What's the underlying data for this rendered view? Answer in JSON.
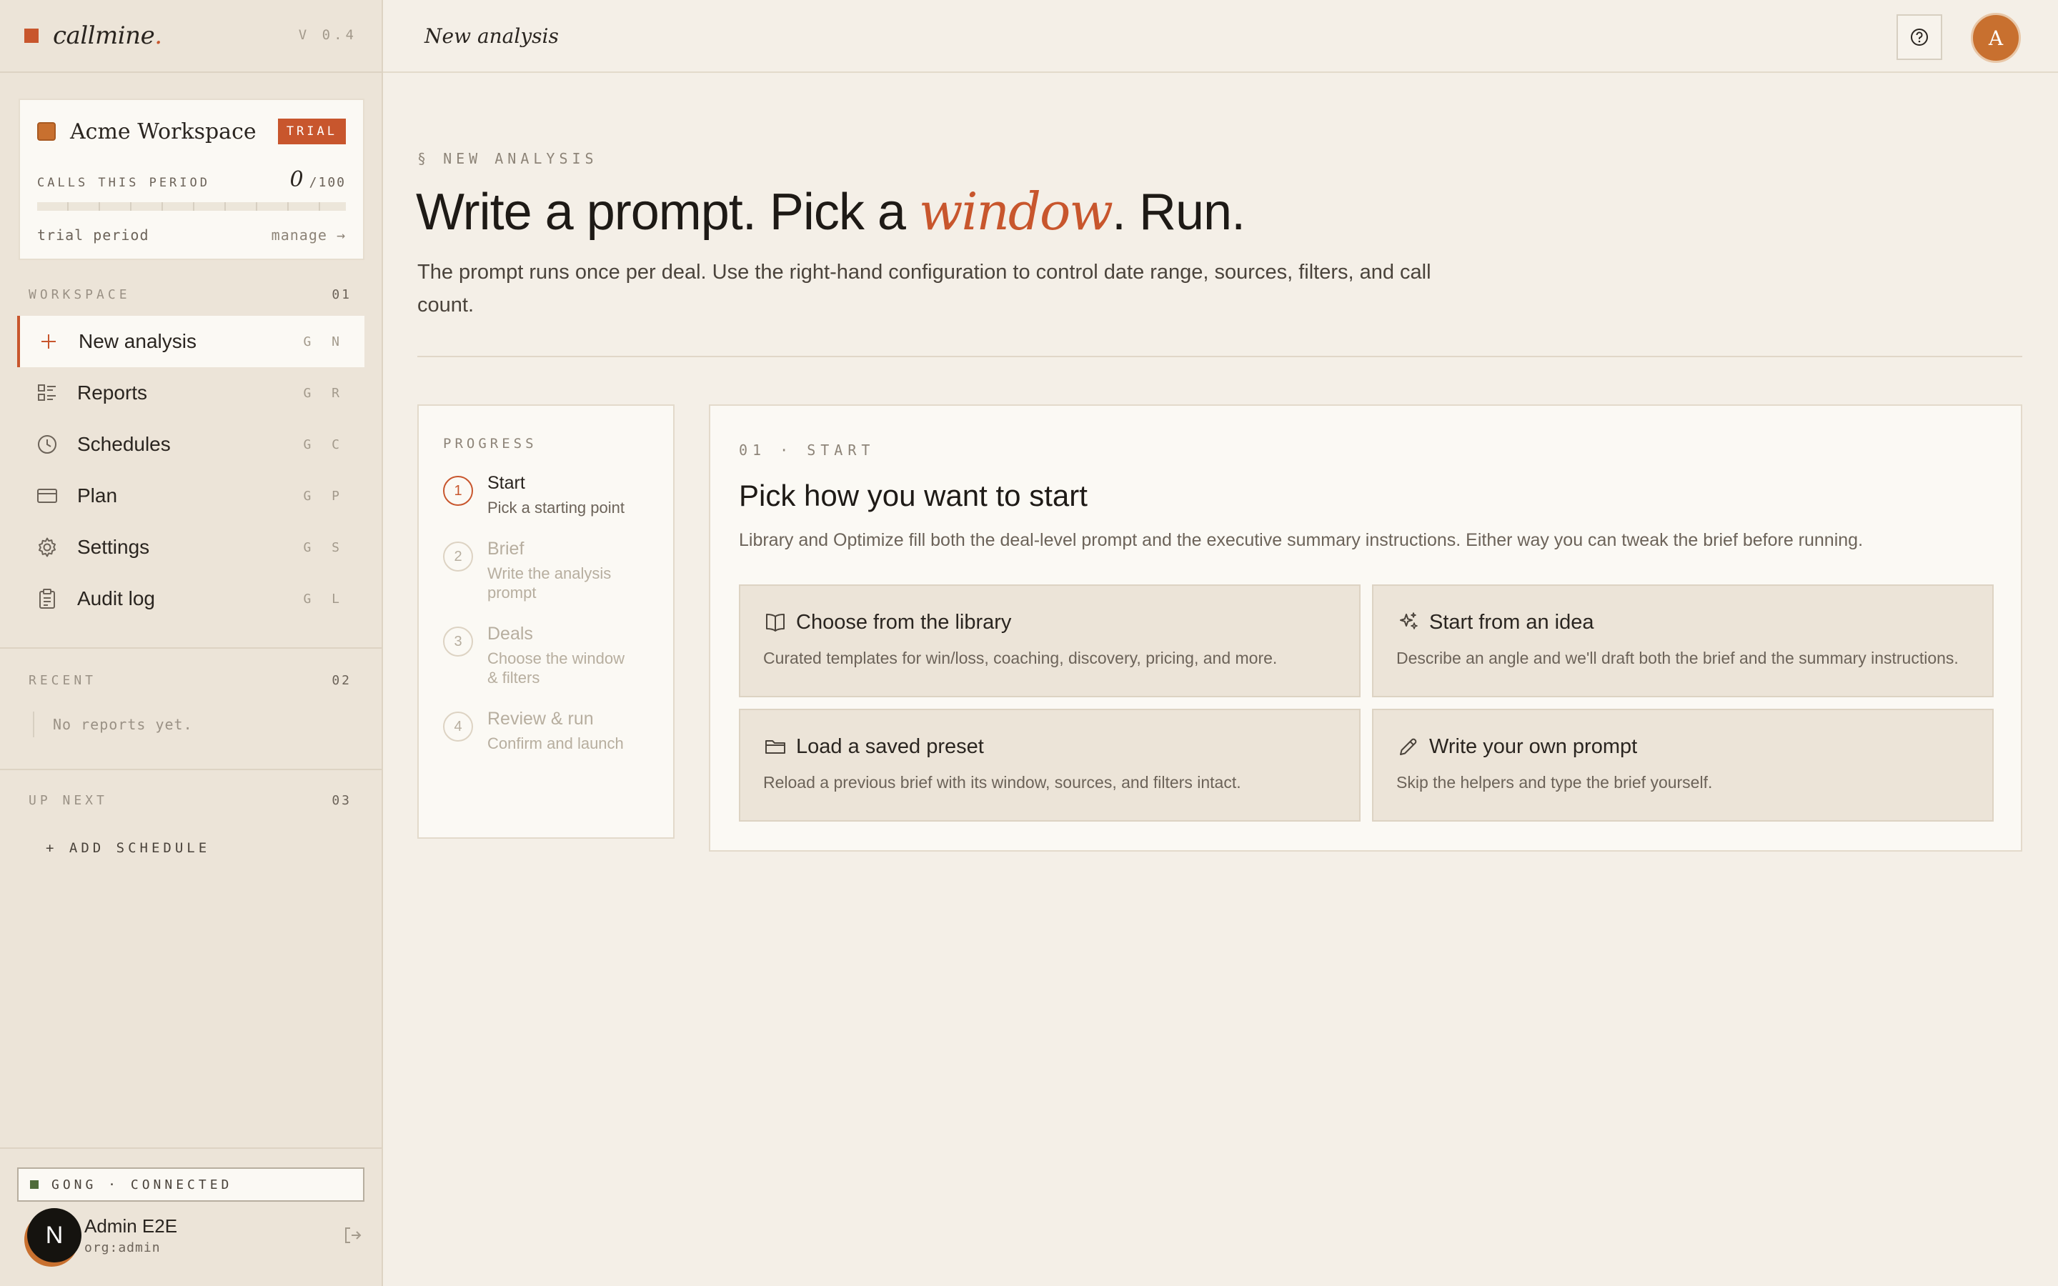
{
  "brand": {
    "name": "callmine",
    "dot": ".",
    "version": "V 0.4"
  },
  "workspace": {
    "name": "Acme Workspace",
    "badge": "TRIAL",
    "calls_label": "CALLS THIS PERIOD",
    "calls_used": "0",
    "calls_max": "/100",
    "usage_fraction": 0,
    "status": "trial period",
    "manage": "manage →"
  },
  "sections": {
    "workspace": {
      "label": "WORKSPACE",
      "num": "01"
    },
    "recent": {
      "label": "RECENT",
      "num": "02",
      "empty": "No reports yet."
    },
    "upnext": {
      "label": "UP NEXT",
      "num": "03",
      "add": "+ ADD SCHEDULE"
    }
  },
  "nav": [
    {
      "label": "New analysis",
      "key": "G N",
      "icon": "plus-icon"
    },
    {
      "label": "Reports",
      "key": "G R",
      "icon": "list-icon"
    },
    {
      "label": "Schedules",
      "key": "G C",
      "icon": "clock-icon"
    },
    {
      "label": "Plan",
      "key": "G P",
      "icon": "card-icon"
    },
    {
      "label": "Settings",
      "key": "G S",
      "icon": "gear-icon"
    },
    {
      "label": "Audit log",
      "key": "G L",
      "icon": "clipboard-icon"
    }
  ],
  "integration": {
    "label": "GONG · CONNECTED",
    "color": "#4f6b3a"
  },
  "user": {
    "initial": "N",
    "name": "Admin E2E",
    "role": "org:admin"
  },
  "topbar": {
    "title": "New analysis",
    "avatar": "A"
  },
  "page": {
    "eyebrow": "§ NEW ANALYSIS",
    "headline_pre": "Write a prompt. Pick a ",
    "headline_accent": "window",
    "headline_post": ". Run.",
    "lede": "The prompt runs once per deal. Use the right-hand configuration to control date range, sources, filters, and call count."
  },
  "progress": {
    "label": "PROGRESS",
    "steps": [
      {
        "num": "1",
        "title": "Start",
        "sub": "Pick a starting point"
      },
      {
        "num": "2",
        "title": "Brief",
        "sub": "Write the analysis prompt"
      },
      {
        "num": "3",
        "title": "Deals",
        "sub": "Choose the window & filters"
      },
      {
        "num": "4",
        "title": "Review & run",
        "sub": "Confirm and launch"
      }
    ]
  },
  "start": {
    "eyebrow": "01 · START",
    "title": "Pick how you want to start",
    "desc": "Library and Optimize fill both the deal-level prompt and the executive summary instructions. Either way you can tweak the brief before running.",
    "options": [
      {
        "title": "Choose from the library",
        "desc": "Curated templates for win/loss, coaching, discovery, pricing, and more.",
        "icon": "book-icon"
      },
      {
        "title": "Start from an idea",
        "desc": "Describe an angle and we'll draft both the brief and the summary instructions.",
        "icon": "sparkle-icon"
      },
      {
        "title": "Load a saved preset",
        "desc": "Reload a previous brief with its window, sources, and filters intact.",
        "icon": "folder-icon"
      },
      {
        "title": "Write your own prompt",
        "desc": "Skip the helpers and type the brief yourself.",
        "icon": "pencil-icon"
      }
    ]
  },
  "colors": {
    "accent": "#c8562d",
    "sidebar": "#ece4d8",
    "background": "#f4efe7"
  }
}
